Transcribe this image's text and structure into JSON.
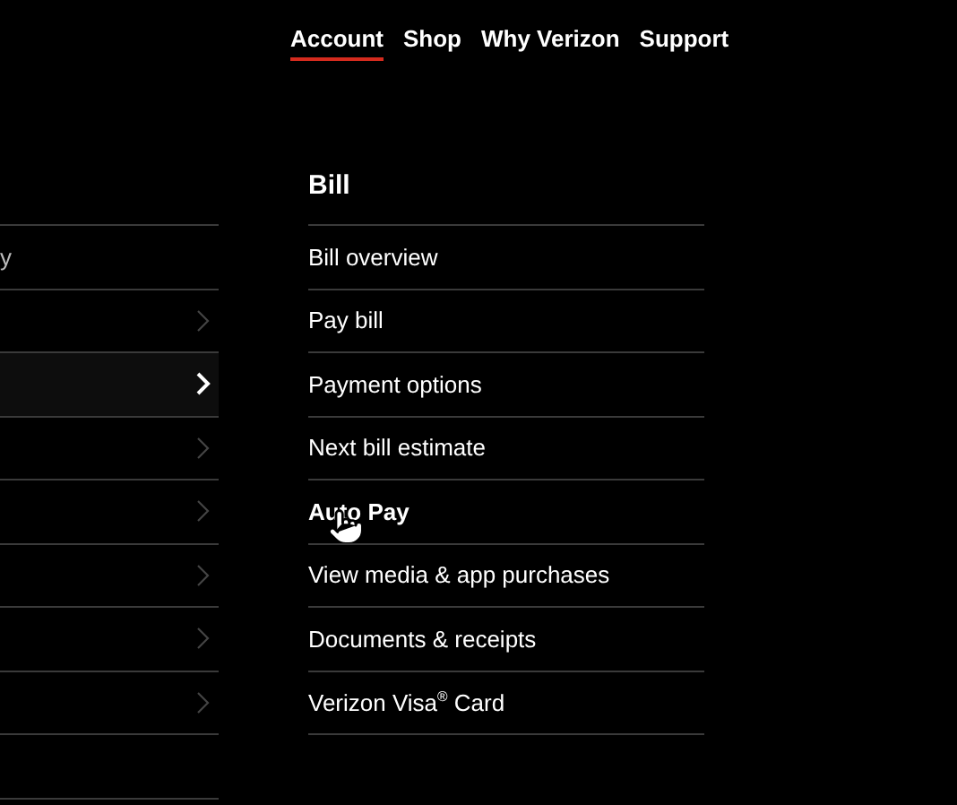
{
  "top_nav": [
    {
      "label": "Account",
      "selected": true
    },
    {
      "label": "Shop",
      "selected": false
    },
    {
      "label": "Why Verizon",
      "selected": false
    },
    {
      "label": "Support",
      "selected": false
    }
  ],
  "left_menu": [
    {
      "label": "y",
      "has_chevron": false,
      "selected": false
    },
    {
      "has_chevron": true,
      "selected": false
    },
    {
      "has_chevron": true,
      "selected": true
    },
    {
      "has_chevron": true,
      "selected": false
    },
    {
      "has_chevron": true,
      "selected": false
    },
    {
      "has_chevron": true,
      "selected": false
    },
    {
      "has_chevron": true,
      "selected": false
    },
    {
      "has_chevron": true,
      "selected": false
    },
    {
      "has_chevron": false,
      "selected": false
    }
  ],
  "submenu": {
    "title": "Bill",
    "items": [
      {
        "label": "Bill overview",
        "hovered": false
      },
      {
        "label": "Pay bill",
        "hovered": false
      },
      {
        "label": "Payment options",
        "hovered": false
      },
      {
        "label": "Next bill estimate",
        "hovered": false
      },
      {
        "label": "Auto Pay",
        "hovered": true
      },
      {
        "label": "View media & app purchases",
        "hovered": false
      },
      {
        "label": "Documents & receipts",
        "hovered": false
      },
      {
        "label": "Verizon Visa$^{®}$ Card",
        "hovered": false
      }
    ]
  }
}
